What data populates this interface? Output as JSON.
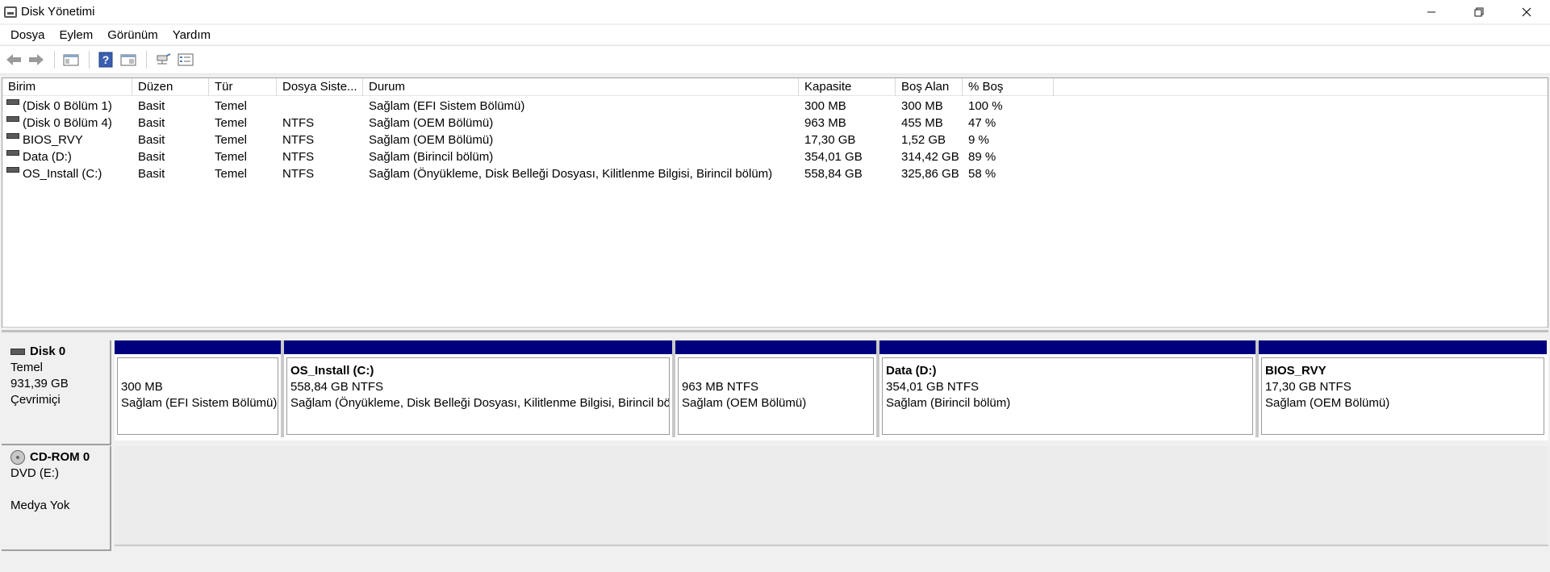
{
  "window": {
    "title": "Disk Yönetimi",
    "controls": [
      "minimize",
      "restore",
      "close"
    ]
  },
  "menu": [
    "Dosya",
    "Eylem",
    "Görünüm",
    "Yardım"
  ],
  "toolbar": {
    "icons": [
      "back-arrow-icon",
      "forward-arrow-icon",
      "console-tree-icon",
      "help-icon",
      "properties-icon",
      "connect-icon",
      "list-view-icon"
    ]
  },
  "volume_list": {
    "columns": [
      "Birim",
      "Düzen",
      "Tür",
      "Dosya Siste...",
      "Durum",
      "Kapasite",
      "Boş Alan",
      "% Boş"
    ],
    "rows": [
      [
        "(Disk 0 Bölüm 1)",
        "Basit",
        "Temel",
        "",
        "Sağlam (EFI Sistem Bölümü)",
        "300 MB",
        "300 MB",
        "100 %"
      ],
      [
        "(Disk 0 Bölüm 4)",
        "Basit",
        "Temel",
        "NTFS",
        "Sağlam (OEM Bölümü)",
        "963 MB",
        "455 MB",
        "47 %"
      ],
      [
        "BIOS_RVY",
        "Basit",
        "Temel",
        "NTFS",
        "Sağlam (OEM Bölümü)",
        "17,30 GB",
        "1,52 GB",
        "9 %"
      ],
      [
        "Data (D:)",
        "Basit",
        "Temel",
        "NTFS",
        "Sağlam (Birincil bölüm)",
        "354,01 GB",
        "314,42 GB",
        "89 %"
      ],
      [
        "OS_Install (C:)",
        "Basit",
        "Temel",
        "NTFS",
        "Sağlam (Önyükleme, Disk Belleği Dosyası, Kilitlenme Bilgisi, Birincil bölüm)",
        "558,84 GB",
        "325,86 GB",
        "58 %"
      ]
    ]
  },
  "disks": [
    {
      "name": "Disk 0",
      "type": "Temel",
      "size": "931,39 GB",
      "status": "Çevrimiçi",
      "partitions": [
        {
          "name": "",
          "size": "300 MB",
          "status": "Sağlam (EFI Sistem Bölümü)"
        },
        {
          "name": "OS_Install  (C:)",
          "size": "558,84 GB NTFS",
          "status": "Sağlam (Önyükleme, Disk Belleği Dosyası, Kilitlenme Bilgisi, Birincil bö"
        },
        {
          "name": "",
          "size": "963 MB NTFS",
          "status": "Sağlam (OEM Bölümü)"
        },
        {
          "name": "Data  (D:)",
          "size": "354,01 GB NTFS",
          "status": "Sağlam (Birincil bölüm)"
        },
        {
          "name": "BIOS_RVY",
          "size": "17,30 GB NTFS",
          "status": "Sağlam (OEM Bölümü)"
        }
      ]
    },
    {
      "name": "CD-ROM 0",
      "type": "DVD (E:)",
      "size": "",
      "status": "Medya Yok"
    }
  ],
  "colors": {
    "partition_bar": "#00007f",
    "background": "#f0f0f0"
  }
}
